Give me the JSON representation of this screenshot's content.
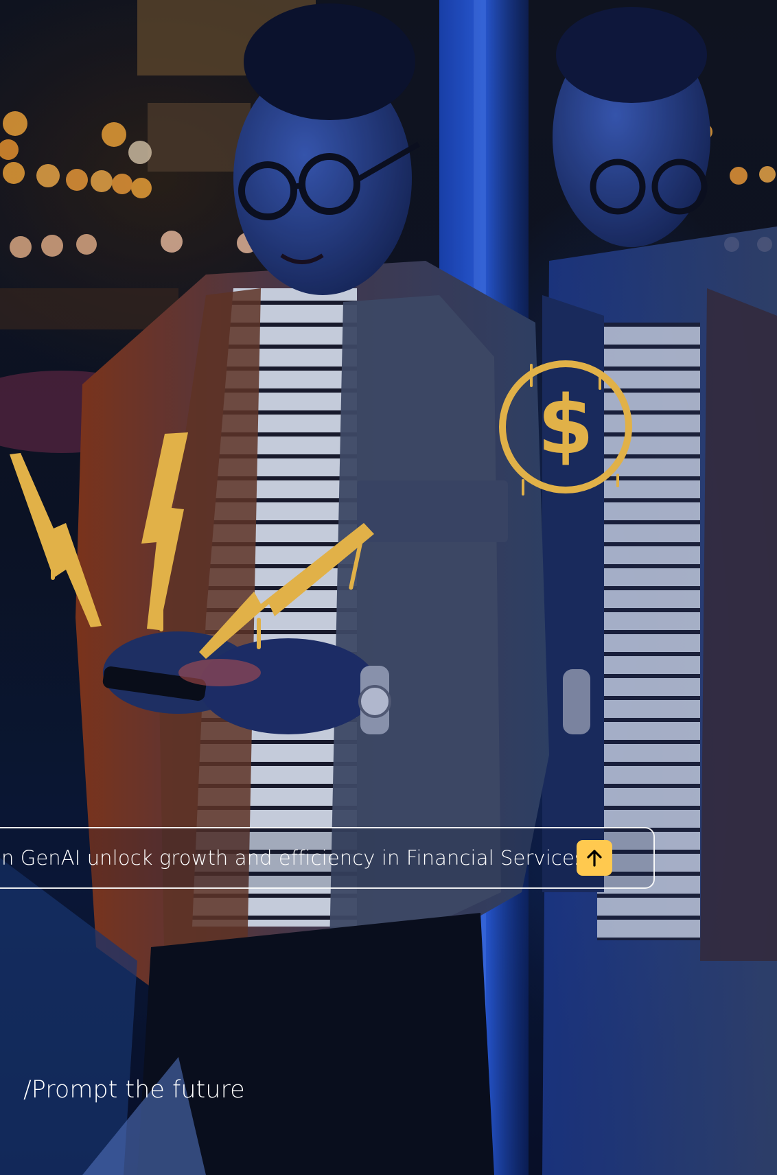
{
  "prompt": {
    "text": "n GenAI unlock growth and efficiency in Financial Services?",
    "send_icon": "arrow-up-icon"
  },
  "tagline": "/Prompt the future",
  "decorations": {
    "icons": [
      "lightning-bolt-icon",
      "lightning-bolt-icon",
      "lightning-bolt-icon",
      "dollar-coin-icon"
    ]
  },
  "colors": {
    "accent": "#ffc94f",
    "text": "#ffffff"
  }
}
